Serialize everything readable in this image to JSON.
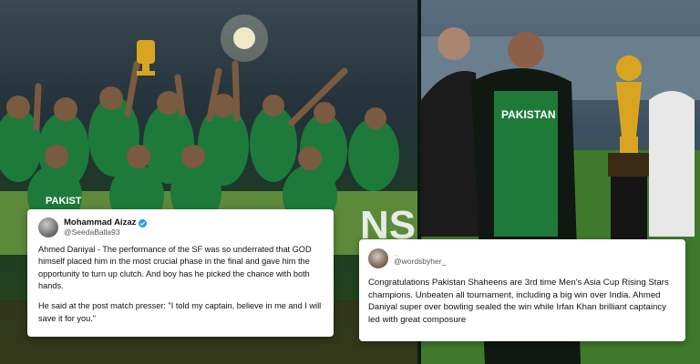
{
  "photos": {
    "left": {
      "description_icon": "team-celebration-photo-icon",
      "banner_text": "NS",
      "jersey_text": "PAKIST"
    },
    "right": {
      "description_icon": "trophy-presentation-photo-icon",
      "jersey_text": "PAKISTAN"
    }
  },
  "tweets": [
    {
      "display_name": "Mohammad Aizaz",
      "handle": "@SeedaBalla93",
      "verified": true,
      "paragraphs": [
        "Ahmed Daniyal - The performance of the SF was so underrated that GOD himself placed him in the most crucial phase in the final and gave him the opportunity to turn up clutch. And boy has he picked the chance with both hands.",
        "He said at the post match presser: \"I told my captain, believe in me and I will save it for you.\""
      ]
    },
    {
      "display_name": "...",
      "handle": "@wordsbyher_",
      "verified": false,
      "paragraphs": [
        "Congratulations Pakistan Shaheens are 3rd time Men's Asia Cup Rising Stars champions. Unbeaten all tournament, including a big win over India. Ahmed Daniyal super over bowling sealed the win while Irfan Khan brilliant captaincy led with great composure"
      ]
    }
  ],
  "colors": {
    "verified": "#1d9bf0",
    "jersey": "#1f7a3a",
    "trophy": "#d9a520"
  }
}
